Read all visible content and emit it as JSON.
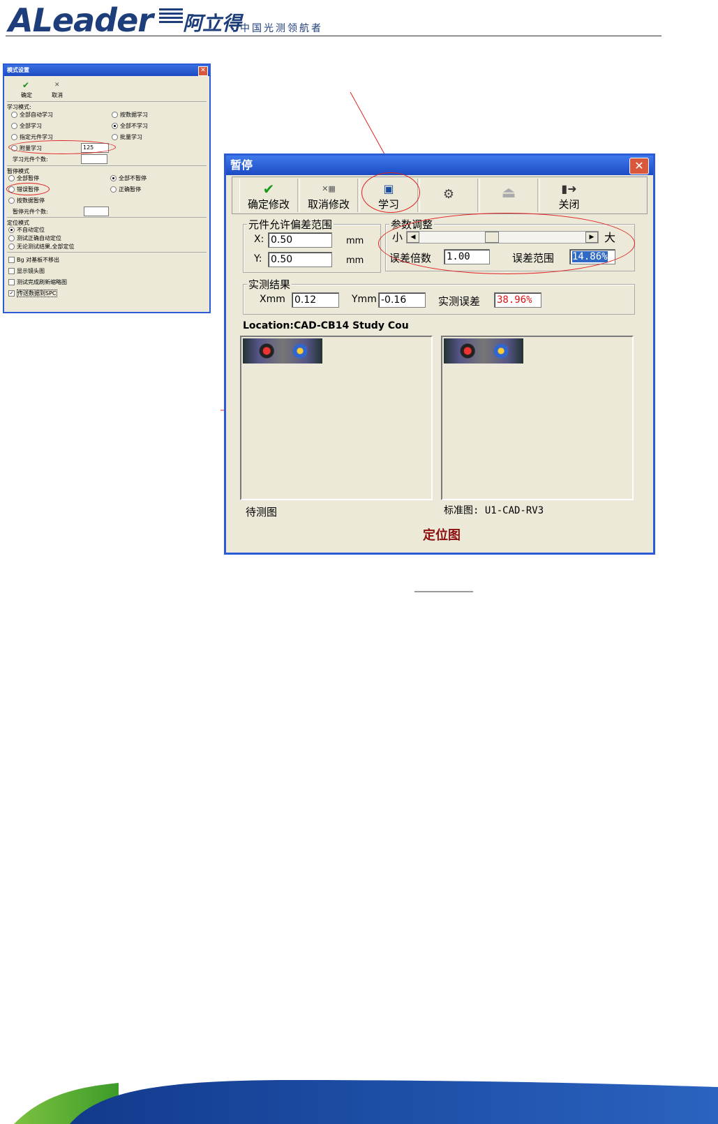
{
  "header": {
    "logo_text": "ALeader",
    "logo_cn": "阿立得",
    "slogan": "中国光测领航者"
  },
  "mode_dialog": {
    "title": "模式设置",
    "toolbar": [
      "确定",
      "取消"
    ],
    "learn_section": "学习模式:",
    "learn_options_left": [
      "全部自动学习",
      "全部学习",
      "指定元件学习",
      "附量学习"
    ],
    "learn_options_right": [
      "按数据学习",
      "全部不学习",
      "批量学习"
    ],
    "learn_value": "125",
    "learn_count_label": "学习元件个数:",
    "pause_section": "暂停模式",
    "pause_options": [
      "全部暂停",
      "错误暂停",
      "按数据暂停"
    ],
    "pause_options_right": [
      "全部不暂停",
      "正确暂停"
    ],
    "pause_count_label": "暂停元件个数:",
    "locate_section": "定位模式",
    "locate_options": [
      "不自动定位",
      "测试正确自动定位",
      "无论测试结果,全部定位"
    ],
    "checks": [
      "Bg 对基板不移出",
      "显示镜头图",
      "测试完成刷新缩略图",
      "传送数据到SPC"
    ]
  },
  "pause_dialog": {
    "title": "暂停",
    "toolbar": [
      "确定修改",
      "取消修改",
      "学习",
      "",
      "",
      "关闭"
    ],
    "tolerance_group": "元件允许偏差范围",
    "x_label": "X:",
    "x_value": "0.50",
    "y_label": "Y:",
    "y_value": "0.50",
    "unit": "mm",
    "param_group": "参数调整",
    "small": "小",
    "large": "大",
    "factor_label": "误差倍数",
    "factor_value": "1.00",
    "range_label": "误差范围",
    "range_value": "14.86%",
    "result_group": "实测结果",
    "xmm_label": "Xmm",
    "xmm_value": "0.12",
    "ymm_label": "Ymm",
    "ymm_value": "-0.16",
    "error_label": "实测误差",
    "error_value": "38.96%",
    "location": "Location:CAD-CB14 Study Cou",
    "left_caption": "待测图",
    "right_caption": "标准图: U1-CAD-RV3",
    "footer": "定位图"
  }
}
